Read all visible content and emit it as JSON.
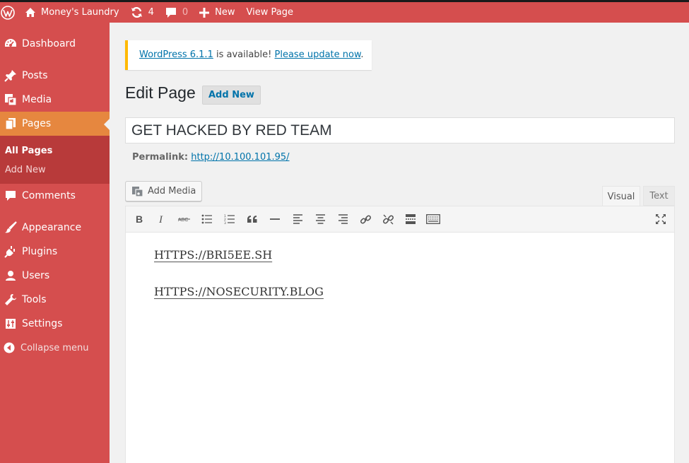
{
  "adminbar": {
    "site_name": "Money's Laundry",
    "updates_count": "4",
    "comments_count": "0",
    "new_label": "New",
    "view_page_label": "View Page"
  },
  "sidebar": {
    "items": [
      {
        "label": "Dashboard",
        "icon": "dashboard-icon"
      },
      {
        "label": "Posts",
        "icon": "pin-icon"
      },
      {
        "label": "Media",
        "icon": "media-icon"
      },
      {
        "label": "Pages",
        "icon": "pages-icon"
      },
      {
        "label": "Comments",
        "icon": "comment-icon"
      },
      {
        "label": "Appearance",
        "icon": "brush-icon"
      },
      {
        "label": "Plugins",
        "icon": "plug-icon"
      },
      {
        "label": "Users",
        "icon": "user-icon"
      },
      {
        "label": "Tools",
        "icon": "wrench-icon"
      },
      {
        "label": "Settings",
        "icon": "sliders-icon"
      }
    ],
    "submenu": [
      "All Pages",
      "Add New"
    ],
    "collapse_label": "Collapse menu"
  },
  "notice": {
    "link1": "WordPress 6.1.1",
    "middle": " is available! ",
    "link2": "Please update now",
    "end": "."
  },
  "page": {
    "heading": "Edit Page",
    "add_new": "Add New",
    "title_value": "GET HACKED BY RED TEAM",
    "permalink_label": "Permalink:",
    "permalink_url": "http://10.100.101.95/"
  },
  "editor": {
    "add_media": "Add Media",
    "tab_visual": "Visual",
    "tab_text": "Text",
    "lines": [
      "HTTPS://BRI5EE.SH",
      "HTTPS://NOSECURITY.BLOG"
    ]
  },
  "colors": {
    "sidebar": "#d54e4e",
    "current_item": "#e6873f",
    "submenu": "#b83a3a",
    "link": "#0073aa",
    "notice_border": "#ffb900"
  }
}
